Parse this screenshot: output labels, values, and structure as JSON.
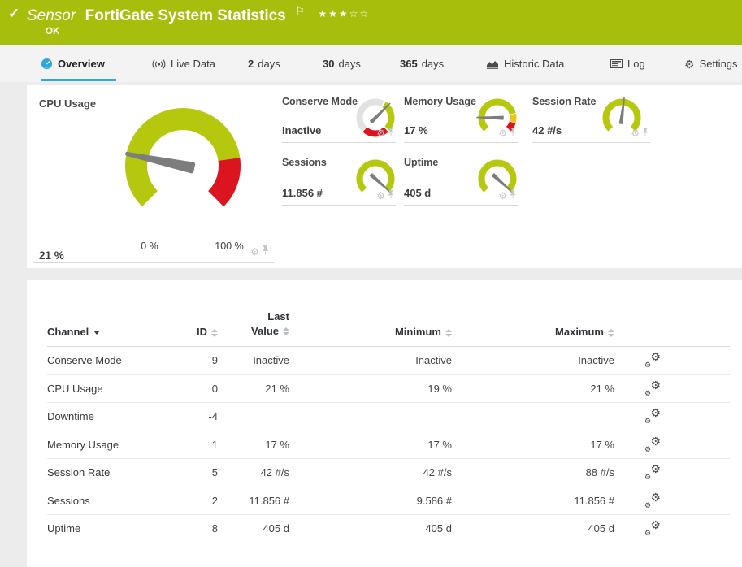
{
  "header": {
    "kind_label": "Sensor",
    "title": "FortiGate System Statistics",
    "status_text": "OK",
    "rating_filled": 3,
    "rating_total": 5
  },
  "colors": {
    "status_ok_green": "#a8be0d",
    "gauge_green": "#b5c80e",
    "gauge_red": "#dc1420",
    "gauge_yellow": "#eec41a",
    "gauge_gray": "#e2e2e2",
    "accent_blue": "#2ea6de",
    "needle_gray": "#7d7d7d"
  },
  "tabs": [
    {
      "label": "Overview",
      "icon": "gauge-icon",
      "active": true
    },
    {
      "label": "Live Data",
      "icon": "broadcast-icon",
      "active": false
    },
    {
      "num": "2",
      "label": "days",
      "active": false
    },
    {
      "num": "30",
      "label": "days",
      "active": false
    },
    {
      "num": "365",
      "label": "days",
      "active": false
    },
    {
      "label": "Historic Data",
      "icon": "chart-icon",
      "active": false
    },
    {
      "label": "Log",
      "icon": "log-icon",
      "active": false
    },
    {
      "label": "Settings",
      "icon": "gear-icon",
      "active": false
    }
  ],
  "gauges": {
    "primary": {
      "title": "CPU Usage",
      "value": "21 %",
      "scale_min_label": "0 %",
      "scale_max_label": "100 %",
      "needle_deg": -78,
      "segments": [
        {
          "from": -135,
          "to": 82,
          "color": "#b5c80e"
        },
        {
          "from": 82,
          "to": 135,
          "color": "#dc1420"
        }
      ]
    },
    "tiles": [
      {
        "title": "Conserve Mode",
        "value": "Inactive",
        "needle_deg": 45,
        "segments": [
          {
            "from": -135,
            "to": 27,
            "color": "#e2e2e2"
          },
          {
            "from": 33,
            "to": 132,
            "color": "#b5c80e"
          },
          {
            "from": 138,
            "to": 222,
            "color": "#dc1420"
          }
        ]
      },
      {
        "title": "Memory Usage",
        "value": "17 %",
        "needle_deg": -89,
        "segments": [
          {
            "from": -135,
            "to": 75,
            "color": "#b5c80e"
          },
          {
            "from": 77,
            "to": 105,
            "color": "#eec41a"
          },
          {
            "from": 107,
            "to": 135,
            "color": "#dc1420"
          }
        ]
      },
      {
        "title": "Session Rate",
        "value": "42 #/s",
        "needle_deg": 7,
        "segments": [
          {
            "from": -135,
            "to": 135,
            "color": "#b5c80e"
          }
        ]
      },
      {
        "title": "Sessions",
        "value": "11.856 #",
        "needle_deg": 132,
        "segments": [
          {
            "from": -135,
            "to": 135,
            "color": "#b5c80e"
          }
        ]
      },
      {
        "title": "Uptime",
        "value": "405 d",
        "needle_deg": 132,
        "segments": [
          {
            "from": -135,
            "to": 135,
            "color": "#b5c80e"
          }
        ]
      }
    ]
  },
  "table": {
    "headers": {
      "channel": "Channel",
      "id": "ID",
      "last_line1": "Last",
      "last_line2": "Value",
      "minimum": "Minimum",
      "maximum": "Maximum"
    },
    "rows": [
      {
        "channel": "Conserve Mode",
        "id": "9",
        "last": "Inactive",
        "min": "Inactive",
        "max": "Inactive"
      },
      {
        "channel": "CPU Usage",
        "id": "0",
        "last": "21 %",
        "min": "19 %",
        "max": "21 %"
      },
      {
        "channel": "Downtime",
        "id": "-4",
        "last": "",
        "min": "",
        "max": ""
      },
      {
        "channel": "Memory Usage",
        "id": "1",
        "last": "17 %",
        "min": "17 %",
        "max": "17 %"
      },
      {
        "channel": "Session Rate",
        "id": "5",
        "last": "42 #/s",
        "min": "42 #/s",
        "max": "88 #/s"
      },
      {
        "channel": "Sessions",
        "id": "2",
        "last": "11.856 #",
        "min": "9.586 #",
        "max": "11.856 #"
      },
      {
        "channel": "Uptime",
        "id": "8",
        "last": "405 d",
        "min": "405 d",
        "max": "405 d"
      }
    ]
  }
}
